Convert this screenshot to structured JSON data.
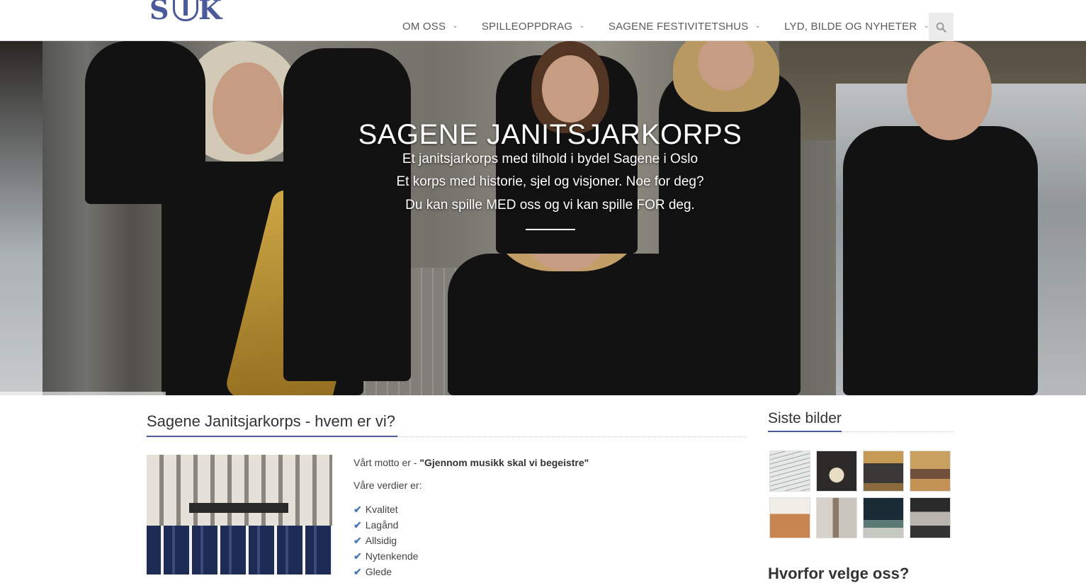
{
  "logo": {
    "letters_left": "S",
    "letters_right": "K",
    "icon": "anchor-emblem-icon"
  },
  "nav": {
    "items": [
      {
        "label": "OM OSS"
      },
      {
        "label": "SPILLEOPPDRAG"
      },
      {
        "label": "SAGENE FESTIVITETSHUS"
      },
      {
        "label": "LYD, BILDE OG NYHETER"
      }
    ],
    "dropdown_icon": "chevron-down-icon",
    "search_icon": "search-icon"
  },
  "hero": {
    "title": "SAGENE JANITSJARKORPS",
    "lines": [
      "Et janitsjarkorps med tilhold i bydel Sagene i Oslo",
      "Et korps med historie, sjel og visjoner. Noe for deg?",
      "Du kan spille MED oss og vi kan spille FOR deg."
    ]
  },
  "main": {
    "title": "Sagene Janitsjarkorps - hvem er vi?",
    "motto_prefix": "Vårt motto er - ",
    "motto": "\"Gjennom musikk skal vi begeistre\"",
    "values_label": "Våre verdier er:",
    "values": [
      "Kvalitet",
      "Lagånd",
      "Allsidig",
      "Nytenkende",
      "Glede"
    ]
  },
  "sidebar": {
    "gallery_title": "Siste bilder",
    "next_title": "Hvorfor velge oss?"
  },
  "colors": {
    "accent": "#4b5a9a",
    "check": "#4a78b8"
  }
}
